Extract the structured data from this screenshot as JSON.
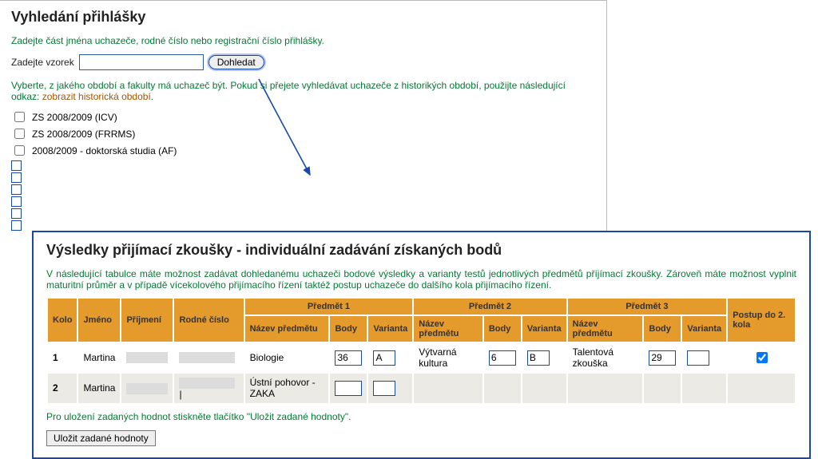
{
  "search": {
    "title": "Vyhledání přihlášky",
    "hint": "Zadejte část jména uchazeče, rodné číslo nebo registrační číslo přihlášky.",
    "input_label": "Zadejte vzorek",
    "input_value": "",
    "button": "Dohledat",
    "period_hint": "Vyberte, z jakého období a fakulty má uchazeč být. Pokud si přejete vyhledávat uchazeče z historikých období, použijte následující odkaz: ",
    "history_link": "zobrazit historická období",
    "periods": [
      "ZS 2008/2009 (ICV)",
      "ZS 2008/2009 (FRRMS)",
      "2008/2009 - doktorská studia (AF)"
    ]
  },
  "results": {
    "title": "Výsledky přijímací zkoušky - individuální zadávání získaných bodů",
    "intro": "V následující tabulce máte možnost zadávat dohledanému uchazeči bodové výsledky a varianty testů jednotlivých předmětů příjímací zkoušky. Zároveň máte možnost vyplnit maturitní průměr a v případě vícekolového přijímacího řízení taktéž postup uchazeče do dalšího kola přijímacího řízení.",
    "headers": {
      "kolo": "Kolo",
      "jmeno": "Jméno",
      "prijmeni": "Příjmení",
      "rodne": "Rodné číslo",
      "predmet1": "Předmět 1",
      "predmet2": "Předmět 2",
      "predmet3": "Předmět 3",
      "nazev": "Název předmětu",
      "body": "Body",
      "varianta": "Varianta",
      "postup": "Postup do 2. kola"
    },
    "rows": [
      {
        "kolo": "1",
        "jmeno": "Martina",
        "p1_name": "Biologie",
        "p1_body": "36",
        "p1_var": "A",
        "p2_name": "Výtvarná kultura",
        "p2_body": "6",
        "p2_var": "B",
        "p3_name": "Talentová zkouška",
        "p3_body": "29",
        "p3_var": "",
        "postup": true
      },
      {
        "kolo": "2",
        "jmeno": "Martina",
        "p1_name": "Ústní pohovor - ZAKA",
        "p1_body": "",
        "p1_var": "",
        "p2_name": "",
        "p2_body": "",
        "p2_var": "",
        "p3_name": "",
        "p3_body": "",
        "p3_var": "",
        "postup": null
      }
    ],
    "save_hint": "Pro uložení zadaných hodnot stiskněte tlačítko \"Uložit zadané hodnoty\".",
    "save_btn": "Uložit zadané hodnoty"
  }
}
